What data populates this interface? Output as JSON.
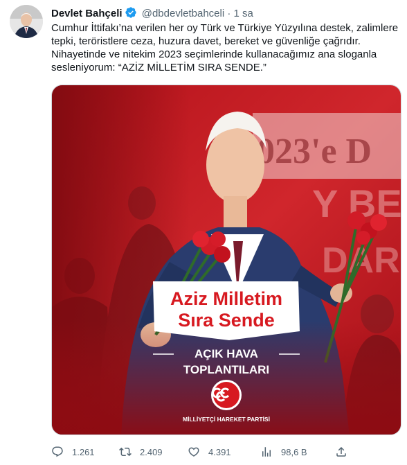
{
  "tweet": {
    "author_name": "Devlet Bahçeli",
    "handle": "@dbdevletbahceli",
    "separator": "·",
    "time": "1 sa",
    "text": "Cumhur İttifakı’na verilen her oy Türk ve Türkiye Yüzyılına destek, zalimlere tepki, teröristlere ceza, huzura davet, bereket ve güvenliğe çağrıdır. Nihayetinde ve nitekim 2023 seçimlerinde kullanacağımız ana sloganla sesleniyorum: “AZİZ MİLLETİM SIRA SENDE.”",
    "verified_icon": "verified-badge-icon"
  },
  "media": {
    "slogan_line1": "Aziz Milletim",
    "slogan_line2": "Sıra Sende",
    "event_line1": "AÇIK HAVA",
    "event_line2": "TOPLANTILARI",
    "party_name": "MİLLİYETÇİ HAREKET PARTİSİ",
    "bg_text1": "023'e D",
    "bg_text2": "Y BE",
    "bg_text3": "DAR",
    "colors": {
      "brand_red": "#d71920",
      "dark_red": "#8c0e14",
      "white": "#ffffff"
    }
  },
  "actions": {
    "replies": "1.261",
    "retweets": "2.409",
    "likes": "4.391",
    "views": "98,6 B"
  }
}
